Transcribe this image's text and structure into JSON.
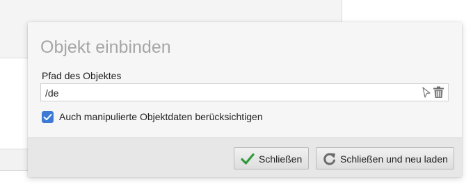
{
  "dialog": {
    "title": "Objekt einbinden",
    "field_label": "Pfad des Objektes",
    "path_value": "/de",
    "checkbox_label": "Auch manipulierte Objektdaten berücksichtigen",
    "checkbox_checked": true
  },
  "buttons": {
    "close_label": "Schließen",
    "reload_label": "Schließen und neu laden"
  },
  "colors": {
    "checkbox": "#3d7ad6",
    "check_icon": "#2e9a3c",
    "title": "#a6a6a6"
  },
  "icons": {
    "path_picker": "cursor-icon",
    "path_clear": "trash-icon",
    "close": "checkmark-icon",
    "reload": "refresh-icon"
  }
}
